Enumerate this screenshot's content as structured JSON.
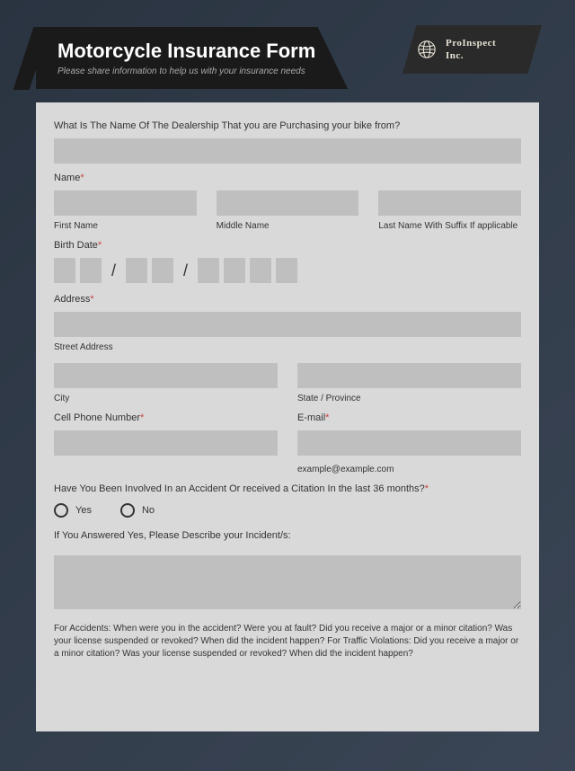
{
  "header": {
    "title": "Motorcycle Insurance Form",
    "subtitle": "Please share information to help us with your insurance needs"
  },
  "logo": {
    "line1": "ProInspect",
    "line2": "Inc."
  },
  "form": {
    "dealership_question": "What Is The Name Of The Dealership That you are Purchasing your bike from?",
    "name_label": "Name",
    "first_name": "First Name",
    "middle_name": "Middle Name",
    "last_name": "Last Name With Suffix If applicable",
    "birth_date": "Birth Date",
    "address_label": "Address",
    "street_address": "Street Address",
    "city": "City",
    "state": "State / Province",
    "phone_label": "Cell Phone Number",
    "email_label": "E-mail",
    "email_example": "example@example.com",
    "accident_question": "Have You Been Involved In an Accident Or received a Citation In the last 36 months?",
    "yes": "Yes",
    "no": "No",
    "describe_label": "If You Answered Yes, Please Describe your Incident/s:",
    "hint_text": "For Accidents: When were you in the accident? Were you at fault? Did you receive a major or a minor citation? Was your license suspended or revoked? When did the incident happen? For Traffic Violations: Did you receive a major or a minor citation? Was your license suspended or revoked? When did the incident happen?",
    "asterisk": "*"
  }
}
